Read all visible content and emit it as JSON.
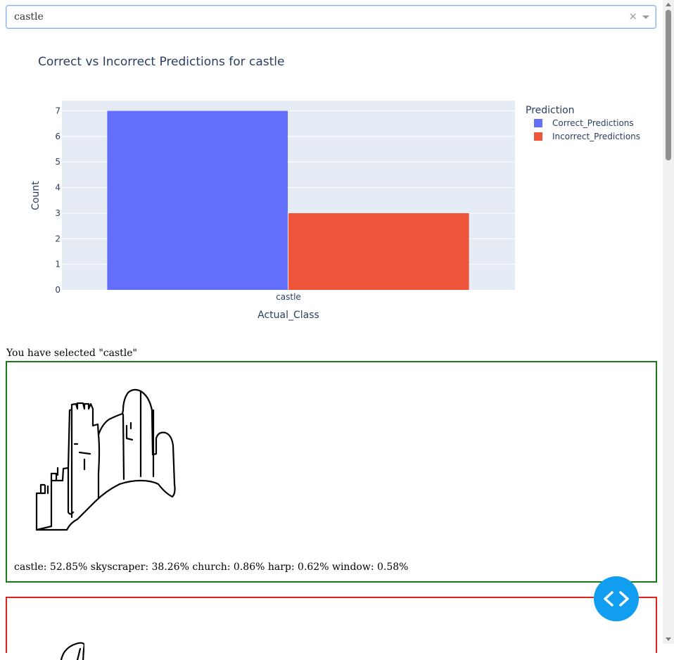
{
  "dropdown": {
    "value": "castle",
    "clear_symbol": "×"
  },
  "chart_data": {
    "type": "bar",
    "title": "Correct vs Incorrect Predictions for castle",
    "xlabel": "Actual_Class",
    "ylabel": "Count",
    "categories": [
      "castle"
    ],
    "series": [
      {
        "name": "Correct_Predictions",
        "values": [
          7
        ],
        "color": "#636efa"
      },
      {
        "name": "Incorrect_Predictions",
        "values": [
          3
        ],
        "color": "#ef553b"
      }
    ],
    "ylim": [
      0,
      7.4
    ],
    "yticks": [
      0,
      1,
      2,
      3,
      4,
      5,
      6,
      7
    ],
    "legend_title": "Prediction",
    "legend_position": "top-right",
    "grid": true,
    "plot_bg": "#e5ecf6"
  },
  "selected_text": "You have selected \"castle\"",
  "cards": [
    {
      "status": "correct",
      "border_color": "#1a7a1a",
      "predictions": "castle: 52.85% skyscraper: 38.26% church: 0.86% harp: 0.62% window: 0.58%"
    },
    {
      "status": "incorrect",
      "border_color": "#e0231c"
    }
  ],
  "fab": {
    "icon": "code-brackets-icon",
    "color": "#119df0"
  }
}
